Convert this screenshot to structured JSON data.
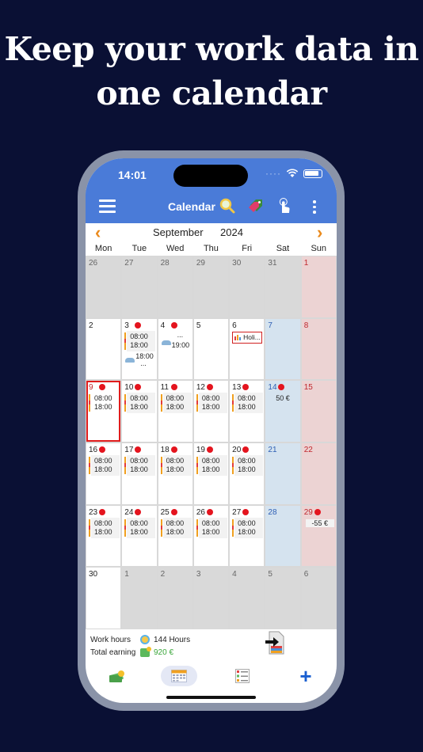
{
  "headline": {
    "line1": "Keep your work data in",
    "line2": "one calendar"
  },
  "status_bar": {
    "time": "14:01",
    "signal": "····"
  },
  "navbar": {
    "title": "Calendar"
  },
  "calendar": {
    "month": "September",
    "year": "2024",
    "prev_icon": "‹",
    "next_icon": "›",
    "weekdays": [
      "Mon",
      "Tue",
      "Wed",
      "Thu",
      "Fri",
      "Sat",
      "Sun"
    ],
    "shift": {
      "start": "08:00",
      "end": "18:00"
    },
    "cells": {
      "r0": [
        "26",
        "27",
        "28",
        "29",
        "30",
        "31",
        "1"
      ],
      "r1": [
        "2",
        "3",
        "4",
        "5",
        "6",
        "7",
        "8"
      ],
      "r2": [
        "9",
        "10",
        "11",
        "12",
        "13",
        "14",
        "15"
      ],
      "r3": [
        "16",
        "17",
        "18",
        "19",
        "20",
        "21",
        "22"
      ],
      "r4": [
        "23",
        "24",
        "25",
        "26",
        "27",
        "28",
        "29"
      ],
      "r5": [
        "30",
        "1",
        "2",
        "3",
        "4",
        "5",
        "6"
      ]
    },
    "tue3_extra": {
      "start": "18:00",
      "more": "..."
    },
    "wed4": {
      "more": "...",
      "end": "19:00"
    },
    "fri6_event": "Holi...",
    "sat14_amount": "50 €",
    "sun29_amount": "-55 €"
  },
  "summary": {
    "work_hours_label": "Work hours",
    "work_hours_value": "144 Hours",
    "total_earning_label": "Total earning",
    "total_earning_value": "920 €",
    "earning_color": "#3aa63a"
  },
  "tabbar": {
    "add_label": "+"
  },
  "colors": {
    "background": "#0a1034",
    "accent": "#4a7bd8",
    "today_border": "#e01c1c",
    "dot": "#e4141e"
  }
}
